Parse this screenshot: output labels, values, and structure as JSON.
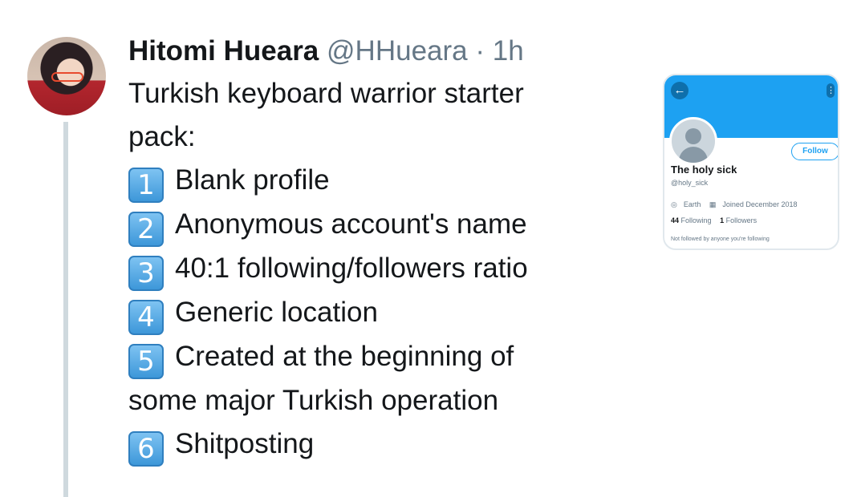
{
  "tweet": {
    "author_name": "Hitomi Hueara",
    "handle": "@HHueara",
    "separator": "·",
    "time": "1h",
    "lines": [
      {
        "badge": "",
        "text": "Turkish keyboard warrior starter"
      },
      {
        "badge": "",
        "text": "pack:"
      },
      {
        "badge": "1",
        "text": "Blank profile"
      },
      {
        "badge": "2",
        "text": "Anonymous account's name"
      },
      {
        "badge": "3",
        "text": "40:1 following/followers ratio"
      },
      {
        "badge": "4",
        "text": "Generic location"
      },
      {
        "badge": "5",
        "text": "Created at the beginning of"
      },
      {
        "badge": "",
        "text": "some major Turkish operation"
      },
      {
        "badge": "6",
        "text": "Shitposting"
      }
    ]
  },
  "profile_card": {
    "back_icon": "←",
    "more_icon": "⋮",
    "follow_label": "Follow",
    "display_name": "The holy sick",
    "handle": "@holy_sick",
    "location": "Earth",
    "location_icon": "◎",
    "joined": "Joined December 2018",
    "calendar_icon": "▦",
    "following_count": "44",
    "following_label": "Following",
    "followers_count": "1",
    "followers_label": "Followers",
    "note": "Not followed by anyone you're following"
  },
  "colors": {
    "banner": "#1da1f2",
    "keycap_badge": "#3d97d9",
    "secondary_text": "#657786"
  }
}
